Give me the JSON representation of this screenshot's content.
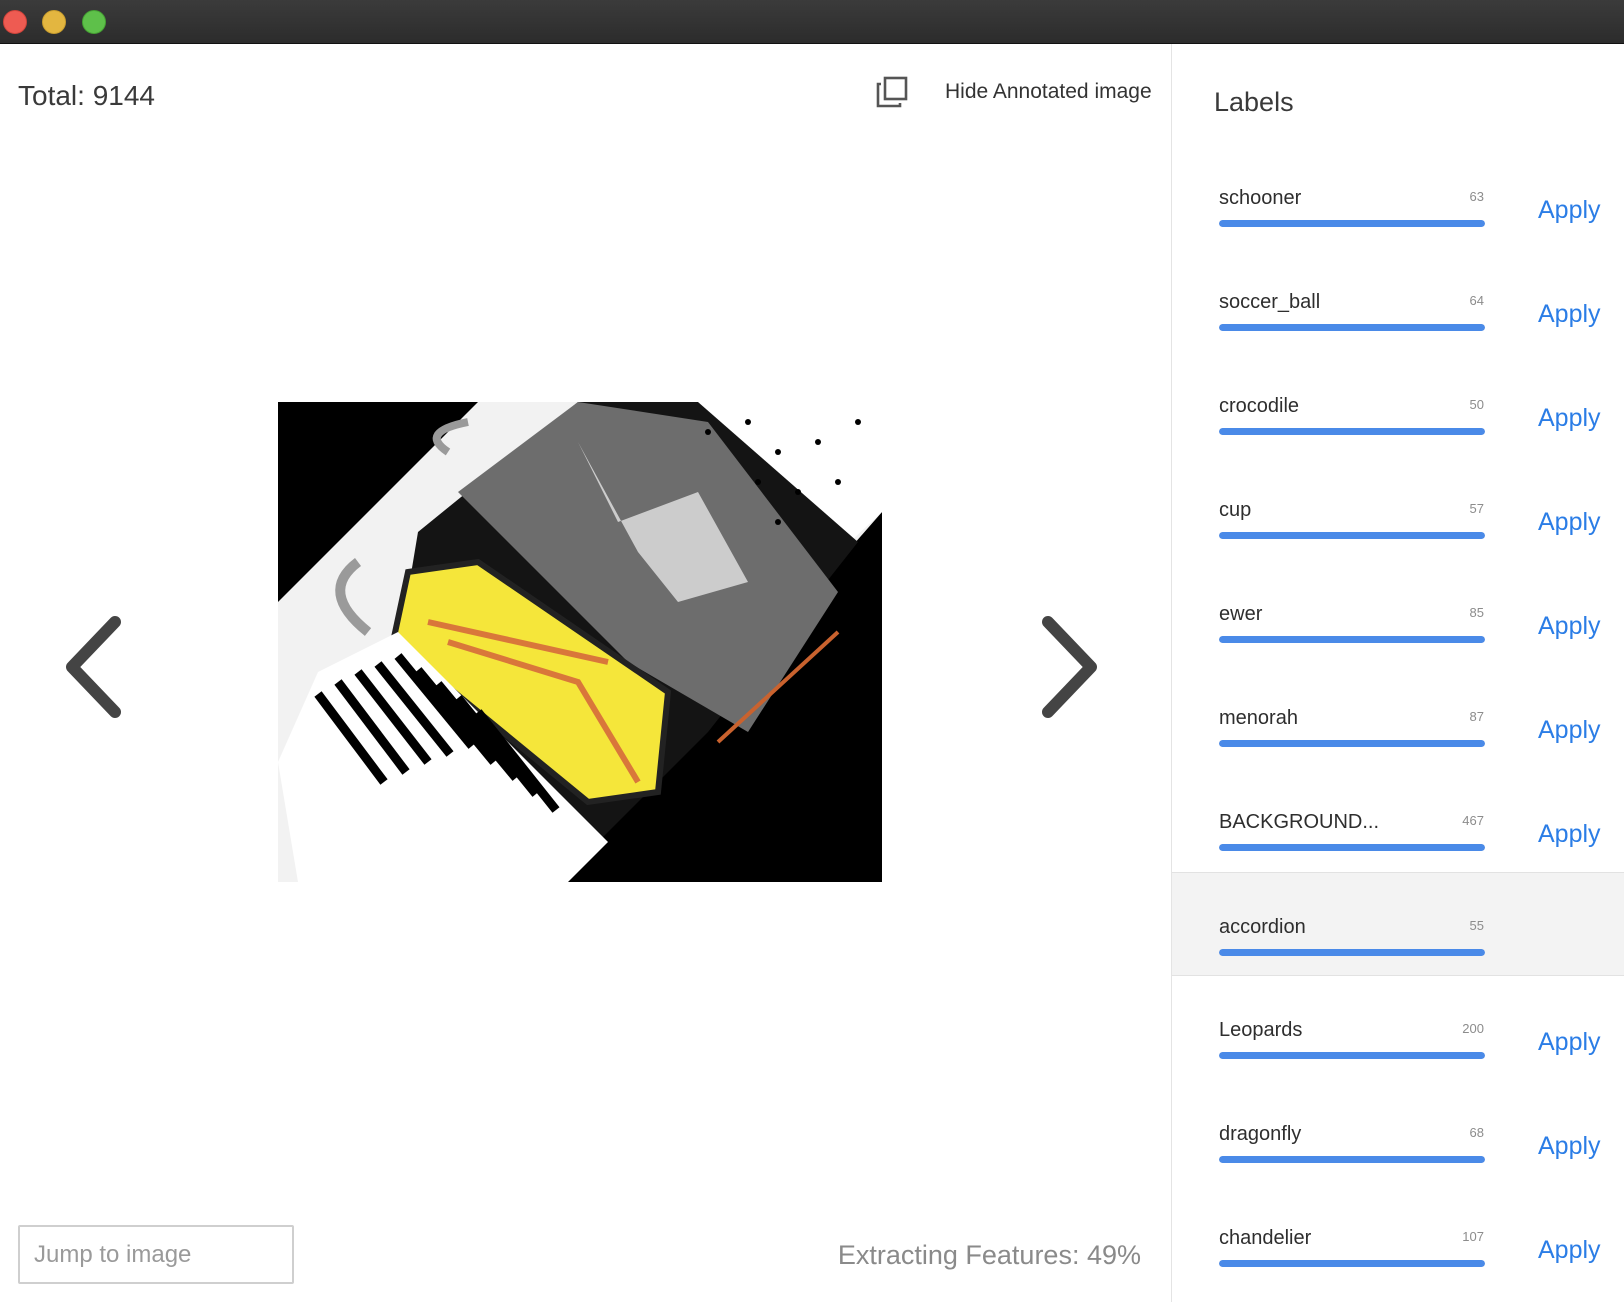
{
  "header": {
    "total_label": "Total: 9144",
    "toggle_label": "Hide Annotated image"
  },
  "footer": {
    "jump_placeholder": "Jump to image",
    "status": "Extracting Features: 49%"
  },
  "sidebar": {
    "title": "Labels",
    "apply_label": "Apply",
    "bar_color": "#4a8ae8",
    "items": [
      {
        "name": "schooner",
        "count": "63",
        "progress": 1.0,
        "selected": false
      },
      {
        "name": "soccer_ball",
        "count": "64",
        "progress": 1.0,
        "selected": false
      },
      {
        "name": "crocodile",
        "count": "50",
        "progress": 1.0,
        "selected": false
      },
      {
        "name": "cup",
        "count": "57",
        "progress": 1.0,
        "selected": false
      },
      {
        "name": "ewer",
        "count": "85",
        "progress": 1.0,
        "selected": false
      },
      {
        "name": "menorah",
        "count": "87",
        "progress": 1.0,
        "selected": false
      },
      {
        "name": "BACKGROUND...",
        "count": "467",
        "progress": 1.0,
        "selected": false
      },
      {
        "name": "accordion",
        "count": "55",
        "progress": 1.0,
        "selected": true
      },
      {
        "name": "Leopards",
        "count": "200",
        "progress": 1.0,
        "selected": false
      },
      {
        "name": "dragonfly",
        "count": "68",
        "progress": 1.0,
        "selected": false
      },
      {
        "name": "chandelier",
        "count": "107",
        "progress": 1.0,
        "selected": false
      }
    ]
  },
  "icons": {
    "copy": "copy-icon",
    "prev": "chevron-left-icon",
    "next": "chevron-right-icon"
  }
}
